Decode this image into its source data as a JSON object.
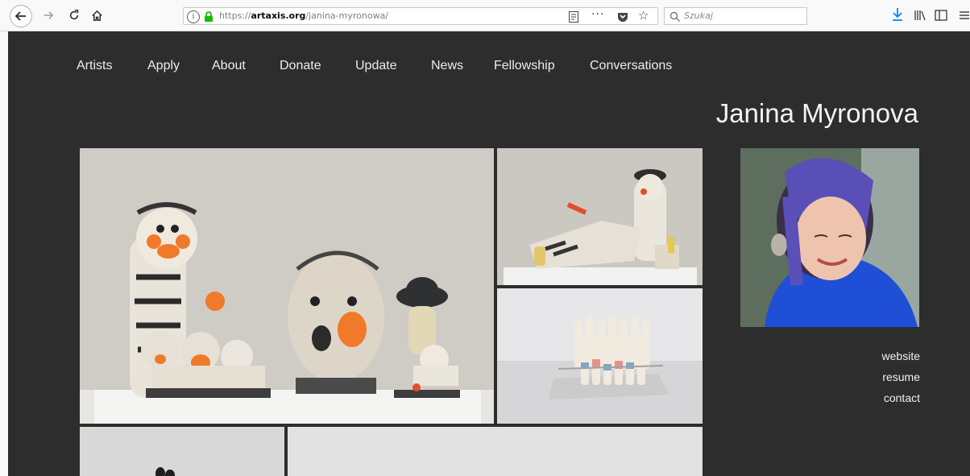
{
  "browser": {
    "url_prefix": "https://",
    "url_domain": "artaxis.org",
    "url_path": "/janina-myronowa/",
    "search_placeholder": "Szukaj"
  },
  "nav": {
    "items": [
      "Artists",
      "Apply",
      "About",
      "Donate",
      "Update",
      "News",
      "Fellowship",
      "Conversations"
    ]
  },
  "artist": {
    "name": "Janina Myronova"
  },
  "links": {
    "website": "website",
    "resume": "resume",
    "contact": "contact"
  },
  "colors": {
    "page_bg": "#2d2d2d",
    "nav_text": "#ececec",
    "accent_orange": "#f07a2a"
  },
  "icons": {
    "back": "back-arrow-icon",
    "forward": "forward-arrow-icon",
    "reload": "reload-icon",
    "home": "home-icon",
    "info": "info-icon",
    "lock": "lock-icon",
    "reader": "reader-view-icon",
    "more": "more-actions-icon",
    "pocket": "pocket-icon",
    "bookmark": "star-icon",
    "search": "search-icon",
    "download": "download-icon",
    "library": "library-icon",
    "sidebar": "sidebar-icon",
    "menu": "menu-icon"
  }
}
